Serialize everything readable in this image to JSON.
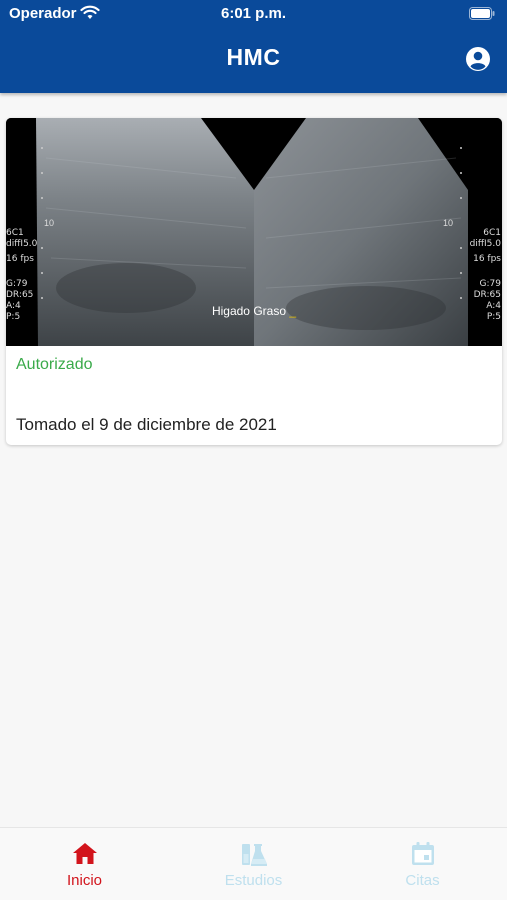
{
  "status_bar": {
    "carrier": "Operador",
    "time": "6:01 p.m."
  },
  "header": {
    "title": "HMC",
    "account_icon": "account-circle-icon"
  },
  "study_card": {
    "image_caption": "Higado Graso",
    "image_caption_cursor": "_",
    "image_left_depth": "10",
    "image_right_depth": "10",
    "image_left_info": [
      "6C1",
      "diffI5.0",
      "",
      "16 fps",
      "",
      "G:79",
      "DR:65",
      "A:4",
      "P:5"
    ],
    "image_right_info": [
      "6C1",
      "diffI5.0",
      "",
      "16 fps",
      "",
      "G:79",
      "DR:65",
      "A:4",
      "P:5"
    ],
    "status": "Autorizado",
    "date": "Tomado el 9 de diciembre de 2021"
  },
  "tabs": [
    {
      "label": "Inicio",
      "icon": "home-icon",
      "active": true
    },
    {
      "label": "Estudios",
      "icon": "lab-flask-icon",
      "active": false
    },
    {
      "label": "Citas",
      "icon": "calendar-icon",
      "active": false
    }
  ],
  "colors": {
    "header": "#0a4a9a",
    "status_authorized": "#3aaa4a",
    "tab_active": "#d2141c",
    "tab_inactive": "#bfe0ee"
  }
}
